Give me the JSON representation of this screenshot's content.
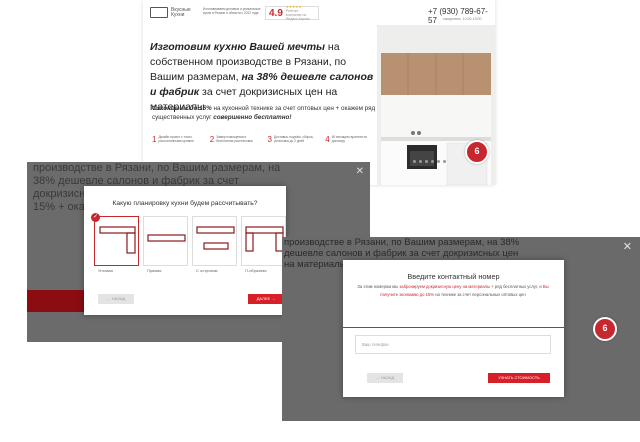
{
  "hero": {
    "logo_line1": "Вкусные",
    "logo_line2": "Кухни",
    "tagline": "Изготавливаем деловые и уникальные кухни в Рязани и области с 2012 года",
    "rating_value": "4.9",
    "rating_stars": "★★★★★",
    "rating_caption": "Рейтинг компании на Яндекс.Картах",
    "phone": "+7 (930) 789-67-57",
    "hours": "ежедневно, 10:00-19:00",
    "headline_bold": "Изготовим кухню Вашей мечты",
    "headline_rest": " на собственном производстве в Рязани, по Вашим размерам,",
    "headline_bold2": "на 38% дешевле салонов и фабрик",
    "headline_rest2": " за счет докризисных цен на материалы",
    "paragraph_part1": "Сэкономим до 15%",
    "paragraph_part2": " на кухонной технике за счет оптовых цен + окажем ряд существенных услуг ",
    "paragraph_part3": "совершенно бесплатно!",
    "steps": [
      {
        "n": "1",
        "t": "Дизайн-проект с точно рассчитанными ценами"
      },
      {
        "n": "2",
        "t": "Замер помещения и бесплатная расстановка"
      },
      {
        "n": "3",
        "t": "Доставка, подъём, сборка, установка до 2 дней"
      },
      {
        "n": "4",
        "t": "60 месяцев гарантии по договору"
      }
    ],
    "badge_number": "6"
  },
  "modal_layout": {
    "question": "Какую планировку кухни будем рассчитывать?",
    "options": [
      "Угловая",
      "Прямая",
      "С островом",
      "П-образная"
    ],
    "back_label": "← НАЗАД",
    "next_label": "ДАЛЕЕ →",
    "bg_text": "производстве в Рязани, по Вашим размерам, на 38% дешевле салонов и фабрик за счет докризисных цен на материалы. Сэкономим до 15% + окажем ряд существ..."
  },
  "modal_contact": {
    "title": "Введите контактный номер",
    "desc1": "За этим номером мы ",
    "desc_red1": "забронируем докризисную цену на материалы",
    "desc2": " + ряд бесплатных услуг, ",
    "desc_red2": "и Вы получите экономию до 15%",
    "desc3": " на технике за счет персональных оптовых цен",
    "phone_placeholder": "Ваш телефон",
    "back_label": "← НАЗАД",
    "submit_label": "УЗНАТЬ СТОИМОСТЬ",
    "bg_text": "производстве в Рязани, по Вашим размерам, на 38% дешевле салонов и фабрик за счет докризисных цен на материалы",
    "badge_number": "6"
  },
  "colors": {
    "accent": "#d71f28",
    "dark_overlay": "#6b6b6b"
  }
}
